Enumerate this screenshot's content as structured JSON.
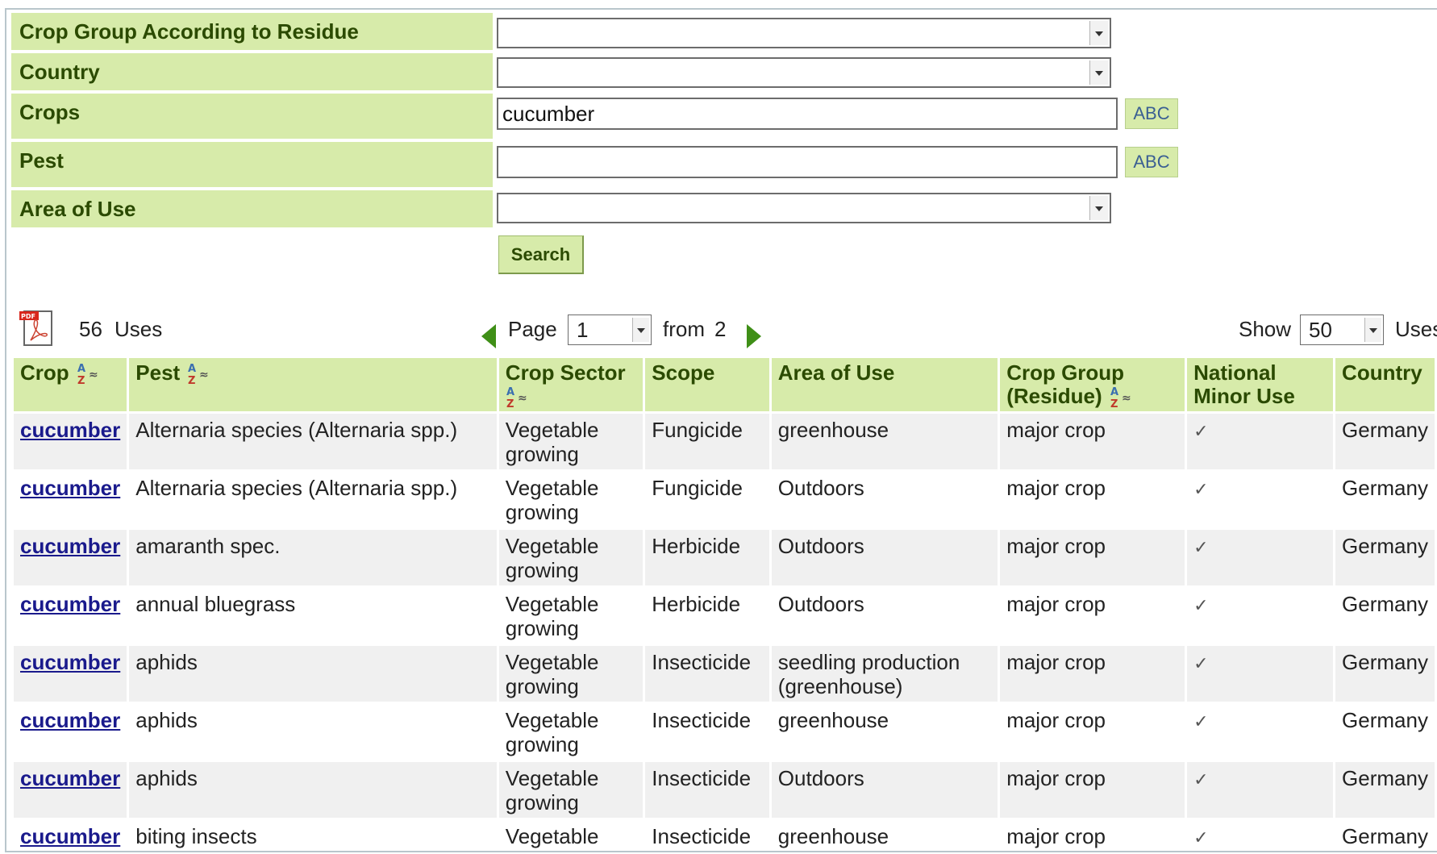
{
  "filters": {
    "crop_group_label": "Crop Group According to Residue",
    "country_label": "Country",
    "crops_label": "Crops",
    "crops_value": "cucumber",
    "pest_label": "Pest",
    "pest_value": "",
    "area_label": "Area of Use",
    "abc_label": "ABC",
    "search_label": "Search"
  },
  "pager": {
    "count": "56",
    "uses_label": "Uses",
    "page_label": "Page",
    "page_value": "1",
    "from_label": "from",
    "total_pages": "2",
    "show_label": "Show",
    "show_value": "50",
    "show_uses_label": "Uses"
  },
  "table": {
    "headers": {
      "crop": "Crop",
      "pest": "Pest",
      "crop_sector": "Crop Sector",
      "scope": "Scope",
      "area": "Area of Use",
      "crop_group_1": "Crop Group",
      "crop_group_2": "(Residue)",
      "national_1": "National",
      "national_2": "Minor Use",
      "country": "Country"
    },
    "rows": [
      {
        "crop": "cucumber",
        "pest": "Alternaria species (Alternaria spp.)",
        "sector_1": "Vegetable",
        "sector_2": "growing",
        "scope": "Fungicide",
        "area_1": "greenhouse",
        "area_2": "",
        "group": "major crop",
        "minor": "✓",
        "country": "Germany"
      },
      {
        "crop": "cucumber",
        "pest": "Alternaria species (Alternaria spp.)",
        "sector_1": "Vegetable",
        "sector_2": "growing",
        "scope": "Fungicide",
        "area_1": "Outdoors",
        "area_2": "",
        "group": "major crop",
        "minor": "✓",
        "country": "Germany"
      },
      {
        "crop": "cucumber",
        "pest": "amaranth spec.",
        "sector_1": "Vegetable",
        "sector_2": "growing",
        "scope": "Herbicide",
        "area_1": "Outdoors",
        "area_2": "",
        "group": "major crop",
        "minor": "✓",
        "country": "Germany"
      },
      {
        "crop": "cucumber",
        "pest": "annual bluegrass",
        "sector_1": "Vegetable",
        "sector_2": "growing",
        "scope": "Herbicide",
        "area_1": "Outdoors",
        "area_2": "",
        "group": "major crop",
        "minor": "✓",
        "country": "Germany"
      },
      {
        "crop": "cucumber",
        "pest": "aphids",
        "sector_1": "Vegetable",
        "sector_2": "growing",
        "scope": "Insecticide",
        "area_1": "seedling production",
        "area_2": "(greenhouse)",
        "group": "major crop",
        "minor": "✓",
        "country": "Germany"
      },
      {
        "crop": "cucumber",
        "pest": "aphids",
        "sector_1": "Vegetable",
        "sector_2": "growing",
        "scope": "Insecticide",
        "area_1": "greenhouse",
        "area_2": "",
        "group": "major crop",
        "minor": "✓",
        "country": "Germany"
      },
      {
        "crop": "cucumber",
        "pest": "aphids",
        "sector_1": "Vegetable",
        "sector_2": "growing",
        "scope": "Insecticide",
        "area_1": "Outdoors",
        "area_2": "",
        "group": "major crop",
        "minor": "✓",
        "country": "Germany"
      },
      {
        "crop": "cucumber",
        "pest": "biting insects",
        "sector_1": "Vegetable",
        "sector_2": "",
        "scope": "Insecticide",
        "area_1": "greenhouse",
        "area_2": "",
        "group": "major crop",
        "minor": "✓",
        "country": "Germany"
      }
    ]
  },
  "colors": {
    "label_bg": "#d7ebaa",
    "label_text": "#2b4a00",
    "link": "#1a1a8c",
    "arrow_green": "#3f8f17"
  }
}
